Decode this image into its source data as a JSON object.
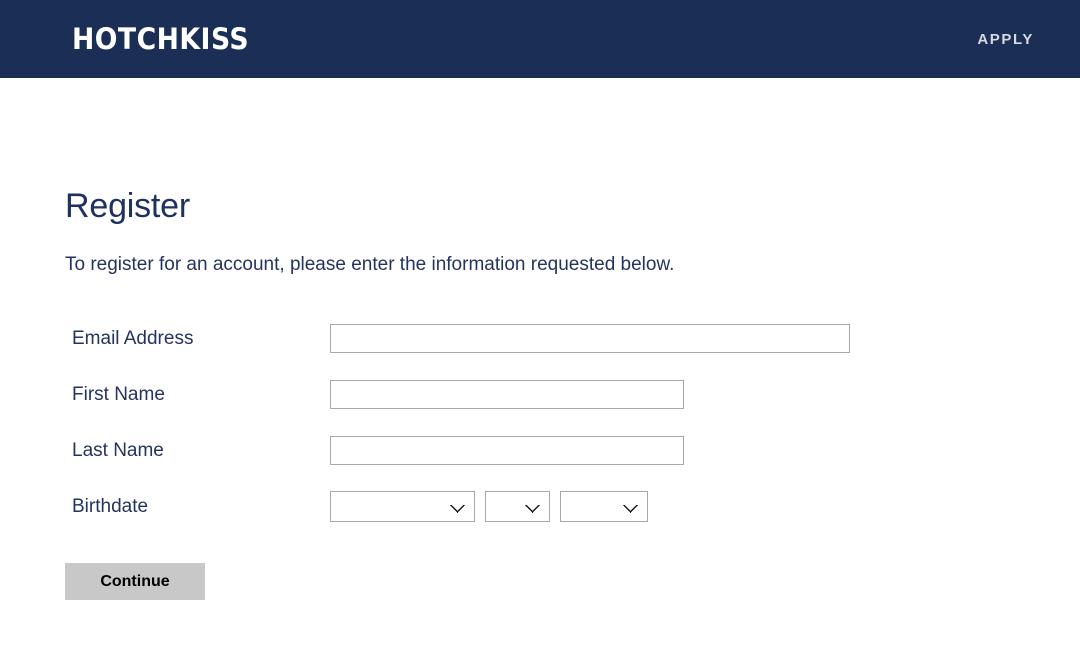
{
  "header": {
    "brand": "HOTCHKISS",
    "apply_label": "APPLY",
    "background_color": "#1A2E56",
    "brand_color": "#FFFFFF",
    "apply_color": "#D6D9E0"
  },
  "main": {
    "title": "Register",
    "intro": "To register for an account, please enter the information requested below.",
    "text_color": "#25335F"
  },
  "form": {
    "fields": [
      {
        "label": "Email Address",
        "value": "",
        "placeholder": ""
      },
      {
        "label": "First Name",
        "value": "",
        "placeholder": ""
      },
      {
        "label": "Last Name",
        "value": "",
        "placeholder": ""
      }
    ],
    "birthdate": {
      "label": "Birthdate",
      "month": {
        "selected": "",
        "options": [
          ""
        ]
      },
      "day": {
        "selected": "",
        "options": [
          ""
        ]
      },
      "year": {
        "selected": "",
        "options": [
          ""
        ]
      }
    },
    "submit_label": "Continue",
    "submit_color": "#C8C8C8",
    "input_border_color": "#A7A7A7"
  },
  "icons": {
    "chevron_down": "chevron-down-icon"
  }
}
